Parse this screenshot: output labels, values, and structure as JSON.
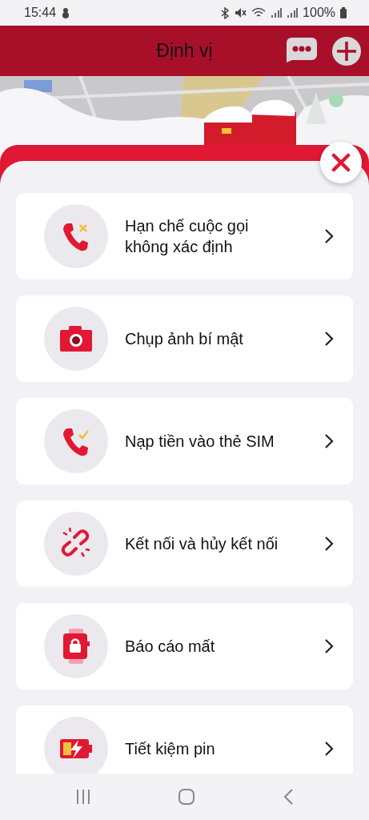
{
  "status_bar": {
    "time": "15:44",
    "battery": "100%"
  },
  "header": {
    "title": "Định vị"
  },
  "menu_items": [
    {
      "label": "Hạn chế cuộc gọi\nkhông xác định"
    },
    {
      "label": "Chụp ảnh bí mật"
    },
    {
      "label": "Nạp tiền vào thẻ SIM"
    },
    {
      "label": "Kết nối và hủy kết nối"
    },
    {
      "label": "Báo cáo mất"
    },
    {
      "label": "Tiết kiệm pin"
    }
  ]
}
